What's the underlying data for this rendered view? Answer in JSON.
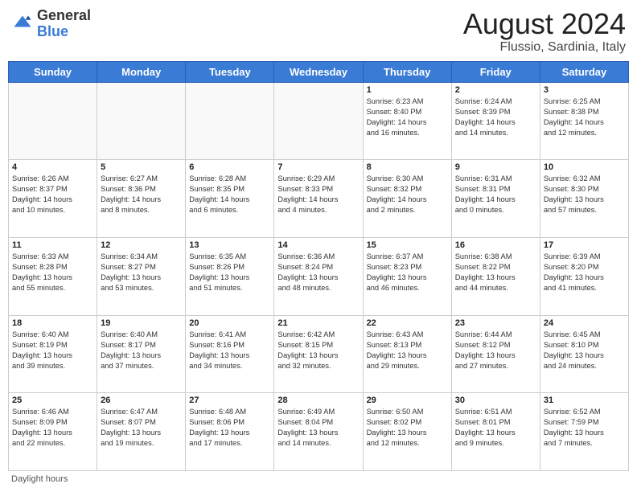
{
  "header": {
    "logo_general": "General",
    "logo_blue": "Blue",
    "month_year": "August 2024",
    "location": "Flussio, Sardinia, Italy"
  },
  "footer": {
    "daylight_label": "Daylight hours"
  },
  "days_of_week": [
    "Sunday",
    "Monday",
    "Tuesday",
    "Wednesday",
    "Thursday",
    "Friday",
    "Saturday"
  ],
  "weeks": [
    [
      {
        "day": "",
        "info": "",
        "empty": true
      },
      {
        "day": "",
        "info": "",
        "empty": true
      },
      {
        "day": "",
        "info": "",
        "empty": true
      },
      {
        "day": "",
        "info": "",
        "empty": true
      },
      {
        "day": "1",
        "info": "Sunrise: 6:23 AM\nSunset: 8:40 PM\nDaylight: 14 hours\nand 16 minutes.",
        "empty": false
      },
      {
        "day": "2",
        "info": "Sunrise: 6:24 AM\nSunset: 8:39 PM\nDaylight: 14 hours\nand 14 minutes.",
        "empty": false
      },
      {
        "day": "3",
        "info": "Sunrise: 6:25 AM\nSunset: 8:38 PM\nDaylight: 14 hours\nand 12 minutes.",
        "empty": false
      }
    ],
    [
      {
        "day": "4",
        "info": "Sunrise: 6:26 AM\nSunset: 8:37 PM\nDaylight: 14 hours\nand 10 minutes.",
        "empty": false
      },
      {
        "day": "5",
        "info": "Sunrise: 6:27 AM\nSunset: 8:36 PM\nDaylight: 14 hours\nand 8 minutes.",
        "empty": false
      },
      {
        "day": "6",
        "info": "Sunrise: 6:28 AM\nSunset: 8:35 PM\nDaylight: 14 hours\nand 6 minutes.",
        "empty": false
      },
      {
        "day": "7",
        "info": "Sunrise: 6:29 AM\nSunset: 8:33 PM\nDaylight: 14 hours\nand 4 minutes.",
        "empty": false
      },
      {
        "day": "8",
        "info": "Sunrise: 6:30 AM\nSunset: 8:32 PM\nDaylight: 14 hours\nand 2 minutes.",
        "empty": false
      },
      {
        "day": "9",
        "info": "Sunrise: 6:31 AM\nSunset: 8:31 PM\nDaylight: 14 hours\nand 0 minutes.",
        "empty": false
      },
      {
        "day": "10",
        "info": "Sunrise: 6:32 AM\nSunset: 8:30 PM\nDaylight: 13 hours\nand 57 minutes.",
        "empty": false
      }
    ],
    [
      {
        "day": "11",
        "info": "Sunrise: 6:33 AM\nSunset: 8:28 PM\nDaylight: 13 hours\nand 55 minutes.",
        "empty": false
      },
      {
        "day": "12",
        "info": "Sunrise: 6:34 AM\nSunset: 8:27 PM\nDaylight: 13 hours\nand 53 minutes.",
        "empty": false
      },
      {
        "day": "13",
        "info": "Sunrise: 6:35 AM\nSunset: 8:26 PM\nDaylight: 13 hours\nand 51 minutes.",
        "empty": false
      },
      {
        "day": "14",
        "info": "Sunrise: 6:36 AM\nSunset: 8:24 PM\nDaylight: 13 hours\nand 48 minutes.",
        "empty": false
      },
      {
        "day": "15",
        "info": "Sunrise: 6:37 AM\nSunset: 8:23 PM\nDaylight: 13 hours\nand 46 minutes.",
        "empty": false
      },
      {
        "day": "16",
        "info": "Sunrise: 6:38 AM\nSunset: 8:22 PM\nDaylight: 13 hours\nand 44 minutes.",
        "empty": false
      },
      {
        "day": "17",
        "info": "Sunrise: 6:39 AM\nSunset: 8:20 PM\nDaylight: 13 hours\nand 41 minutes.",
        "empty": false
      }
    ],
    [
      {
        "day": "18",
        "info": "Sunrise: 6:40 AM\nSunset: 8:19 PM\nDaylight: 13 hours\nand 39 minutes.",
        "empty": false
      },
      {
        "day": "19",
        "info": "Sunrise: 6:40 AM\nSunset: 8:17 PM\nDaylight: 13 hours\nand 37 minutes.",
        "empty": false
      },
      {
        "day": "20",
        "info": "Sunrise: 6:41 AM\nSunset: 8:16 PM\nDaylight: 13 hours\nand 34 minutes.",
        "empty": false
      },
      {
        "day": "21",
        "info": "Sunrise: 6:42 AM\nSunset: 8:15 PM\nDaylight: 13 hours\nand 32 minutes.",
        "empty": false
      },
      {
        "day": "22",
        "info": "Sunrise: 6:43 AM\nSunset: 8:13 PM\nDaylight: 13 hours\nand 29 minutes.",
        "empty": false
      },
      {
        "day": "23",
        "info": "Sunrise: 6:44 AM\nSunset: 8:12 PM\nDaylight: 13 hours\nand 27 minutes.",
        "empty": false
      },
      {
        "day": "24",
        "info": "Sunrise: 6:45 AM\nSunset: 8:10 PM\nDaylight: 13 hours\nand 24 minutes.",
        "empty": false
      }
    ],
    [
      {
        "day": "25",
        "info": "Sunrise: 6:46 AM\nSunset: 8:09 PM\nDaylight: 13 hours\nand 22 minutes.",
        "empty": false
      },
      {
        "day": "26",
        "info": "Sunrise: 6:47 AM\nSunset: 8:07 PM\nDaylight: 13 hours\nand 19 minutes.",
        "empty": false
      },
      {
        "day": "27",
        "info": "Sunrise: 6:48 AM\nSunset: 8:06 PM\nDaylight: 13 hours\nand 17 minutes.",
        "empty": false
      },
      {
        "day": "28",
        "info": "Sunrise: 6:49 AM\nSunset: 8:04 PM\nDaylight: 13 hours\nand 14 minutes.",
        "empty": false
      },
      {
        "day": "29",
        "info": "Sunrise: 6:50 AM\nSunset: 8:02 PM\nDaylight: 13 hours\nand 12 minutes.",
        "empty": false
      },
      {
        "day": "30",
        "info": "Sunrise: 6:51 AM\nSunset: 8:01 PM\nDaylight: 13 hours\nand 9 minutes.",
        "empty": false
      },
      {
        "day": "31",
        "info": "Sunrise: 6:52 AM\nSunset: 7:59 PM\nDaylight: 13 hours\nand 7 minutes.",
        "empty": false
      }
    ]
  ]
}
